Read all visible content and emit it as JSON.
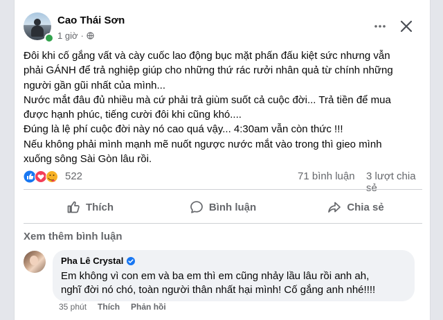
{
  "post": {
    "author": "Cao Thái Sơn",
    "time": "1 giờ",
    "body_lines": [
      "Đôi khi cố gắng vất và cày cuốc lao động bục mặt phấn đấu kiệt sức nhưng vẫn",
      "phải GÁNH để trả nghiệp giúp cho những thứ rác rưởi nhân quả từ chính những",
      "người gần gũi nhất của mình...",
      "Nước mắt đâu đủ nhiều mà cứ phải trả giùm suốt cả cuộc đời... Trả tiền để mua",
      "được hạnh phúc, tiếng cười đôi khi cũng khó....",
      "Đúng là lệ phí cuộc đời này nó cao quá vậy... 4:30am vẫn còn thức !!!",
      "Nếu không phải mình mạnh mẽ nuốt ngược nước mắt vào trong thì gieo mình",
      "xuống sông Sài Gòn lâu rồi."
    ]
  },
  "stats": {
    "reaction_count": "522",
    "comments": "71 bình luận",
    "shares": "3 lượt chia sẻ"
  },
  "actions": {
    "like": "Thích",
    "comment": "Bình luận",
    "share": "Chia sẻ"
  },
  "comments_section": {
    "see_more": "Xem thêm bình luận",
    "comment": {
      "author": "Pha Lê Crystal",
      "text_lines": [
        "Em không vì con em và ba em thì em cũng nhảy lầu lâu rồi anh ah,",
        "nghĩ đời nó chó, toàn người thân nhất hại mình! Cố gắng anh nhé!!!!"
      ],
      "time": "35 phút",
      "like": "Thích",
      "reply": "Phản hồi"
    }
  },
  "colors": {
    "accent": "#1877f2",
    "secondary_text": "#65676b",
    "online": "#31a24c",
    "love": "#f33e58",
    "haha": "#f7b125"
  },
  "icons": [
    "globe-icon",
    "more-horizontal-icon",
    "close-icon",
    "like-reaction-icon",
    "love-reaction-icon",
    "care-reaction-icon",
    "thumb-up-icon",
    "comment-icon",
    "share-icon",
    "verified-badge-icon"
  ]
}
